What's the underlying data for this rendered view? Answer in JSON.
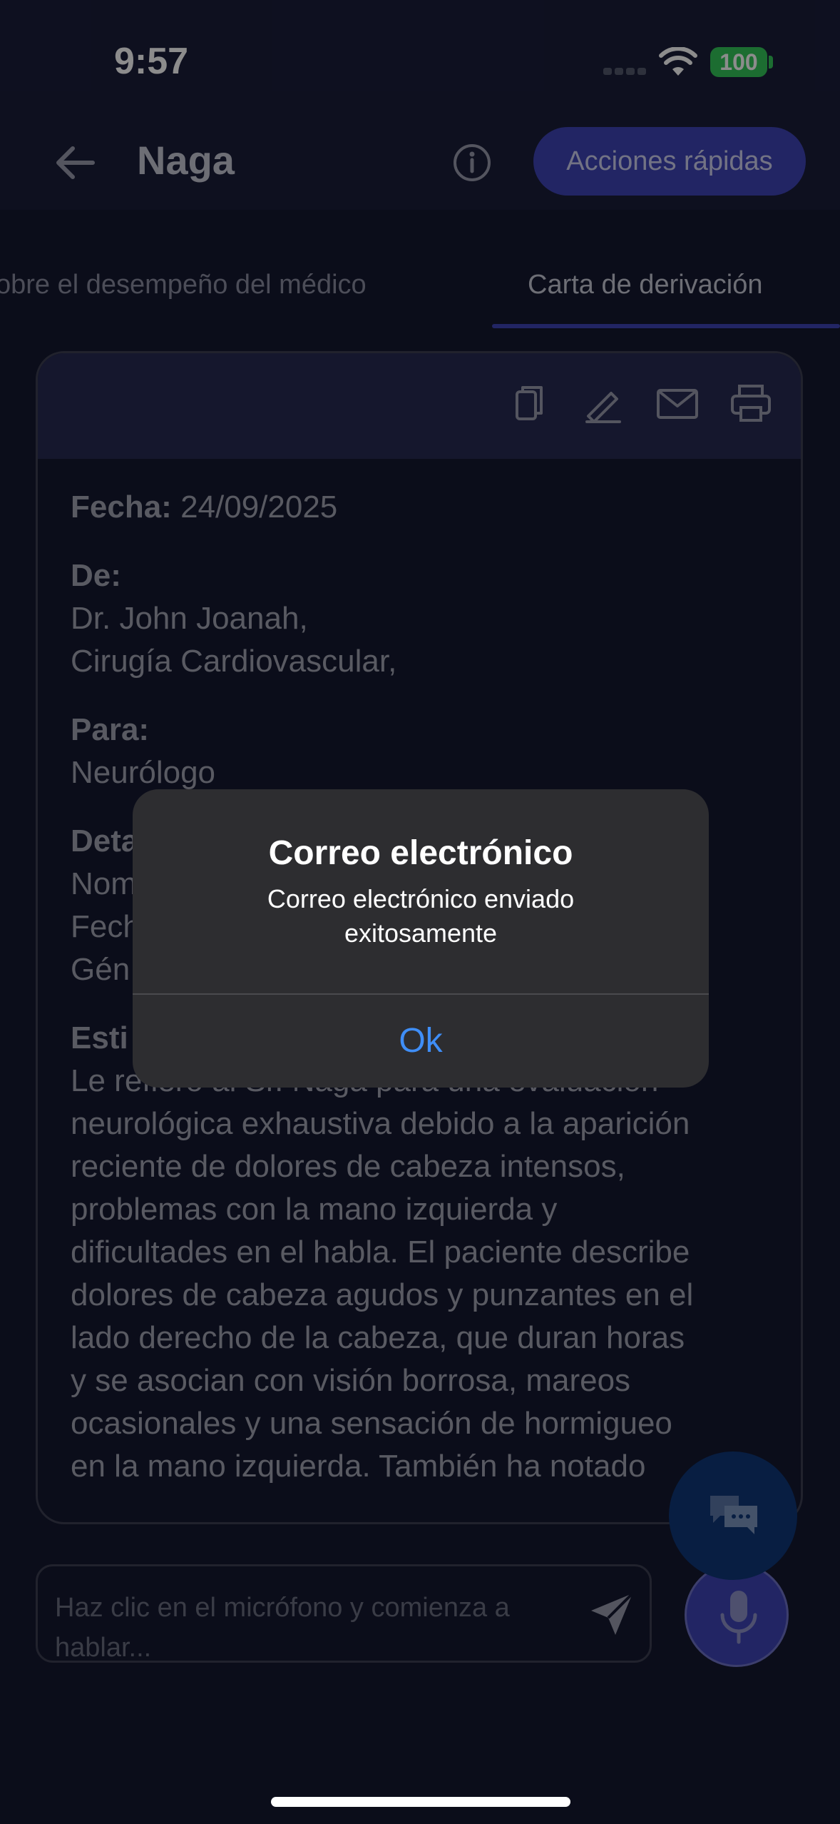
{
  "status_bar": {
    "time": "9:57",
    "battery": "100"
  },
  "header": {
    "title": "Naga",
    "quick_actions_label": "Acciones rápidas"
  },
  "tabs": [
    {
      "label": "obre el desempeño del médico"
    },
    {
      "label": "Carta de derivación"
    }
  ],
  "letter": {
    "date_label": "Fecha:",
    "date_value": "24/09/2025",
    "from_label": "De:",
    "from_lines": [
      "Dr. John Joanah,",
      "Cirugía Cardiovascular,"
    ],
    "to_label": "Para:",
    "to_value": "Neurólogo",
    "details_label": "Deta",
    "details_lines": [
      "Nom",
      "Fech",
      "Gén"
    ],
    "estimation_label": "Esti",
    "body_lines": [
      "Le refiero al Sr. Naga para una evaluación",
      "neurológica exhaustiva debido a la aparición",
      "reciente de dolores de cabeza intensos,",
      "problemas con la mano izquierda y",
      "dificultades en el habla. El paciente describe",
      "dolores de cabeza agudos y punzantes en el",
      "lado derecho de la cabeza, que duran horas",
      "y se asocian con visión borrosa, mareos",
      "ocasionales y una sensación de hormigueo",
      "en la mano izquierda. También ha notado"
    ]
  },
  "modal": {
    "title": "Correo electrónico",
    "message": "Correo electrónico enviado exitosamente",
    "ok_label": "Ok"
  },
  "input": {
    "placeholder": "Haz clic en el micrófono y comienza a hablar..."
  },
  "icons": {
    "back": "arrow-left-icon",
    "info": "info-icon",
    "copy": "copy-icon",
    "edit": "pencil-icon",
    "email": "mail-icon",
    "print": "printer-icon",
    "send": "send-icon",
    "mic": "microphone-icon",
    "chat": "chat-bubbles-icon"
  },
  "colors": {
    "accent": "#3f44b6",
    "background": "#141830",
    "header": "#1a1e3a",
    "link": "#3f8ef7",
    "battery": "#34c759"
  }
}
